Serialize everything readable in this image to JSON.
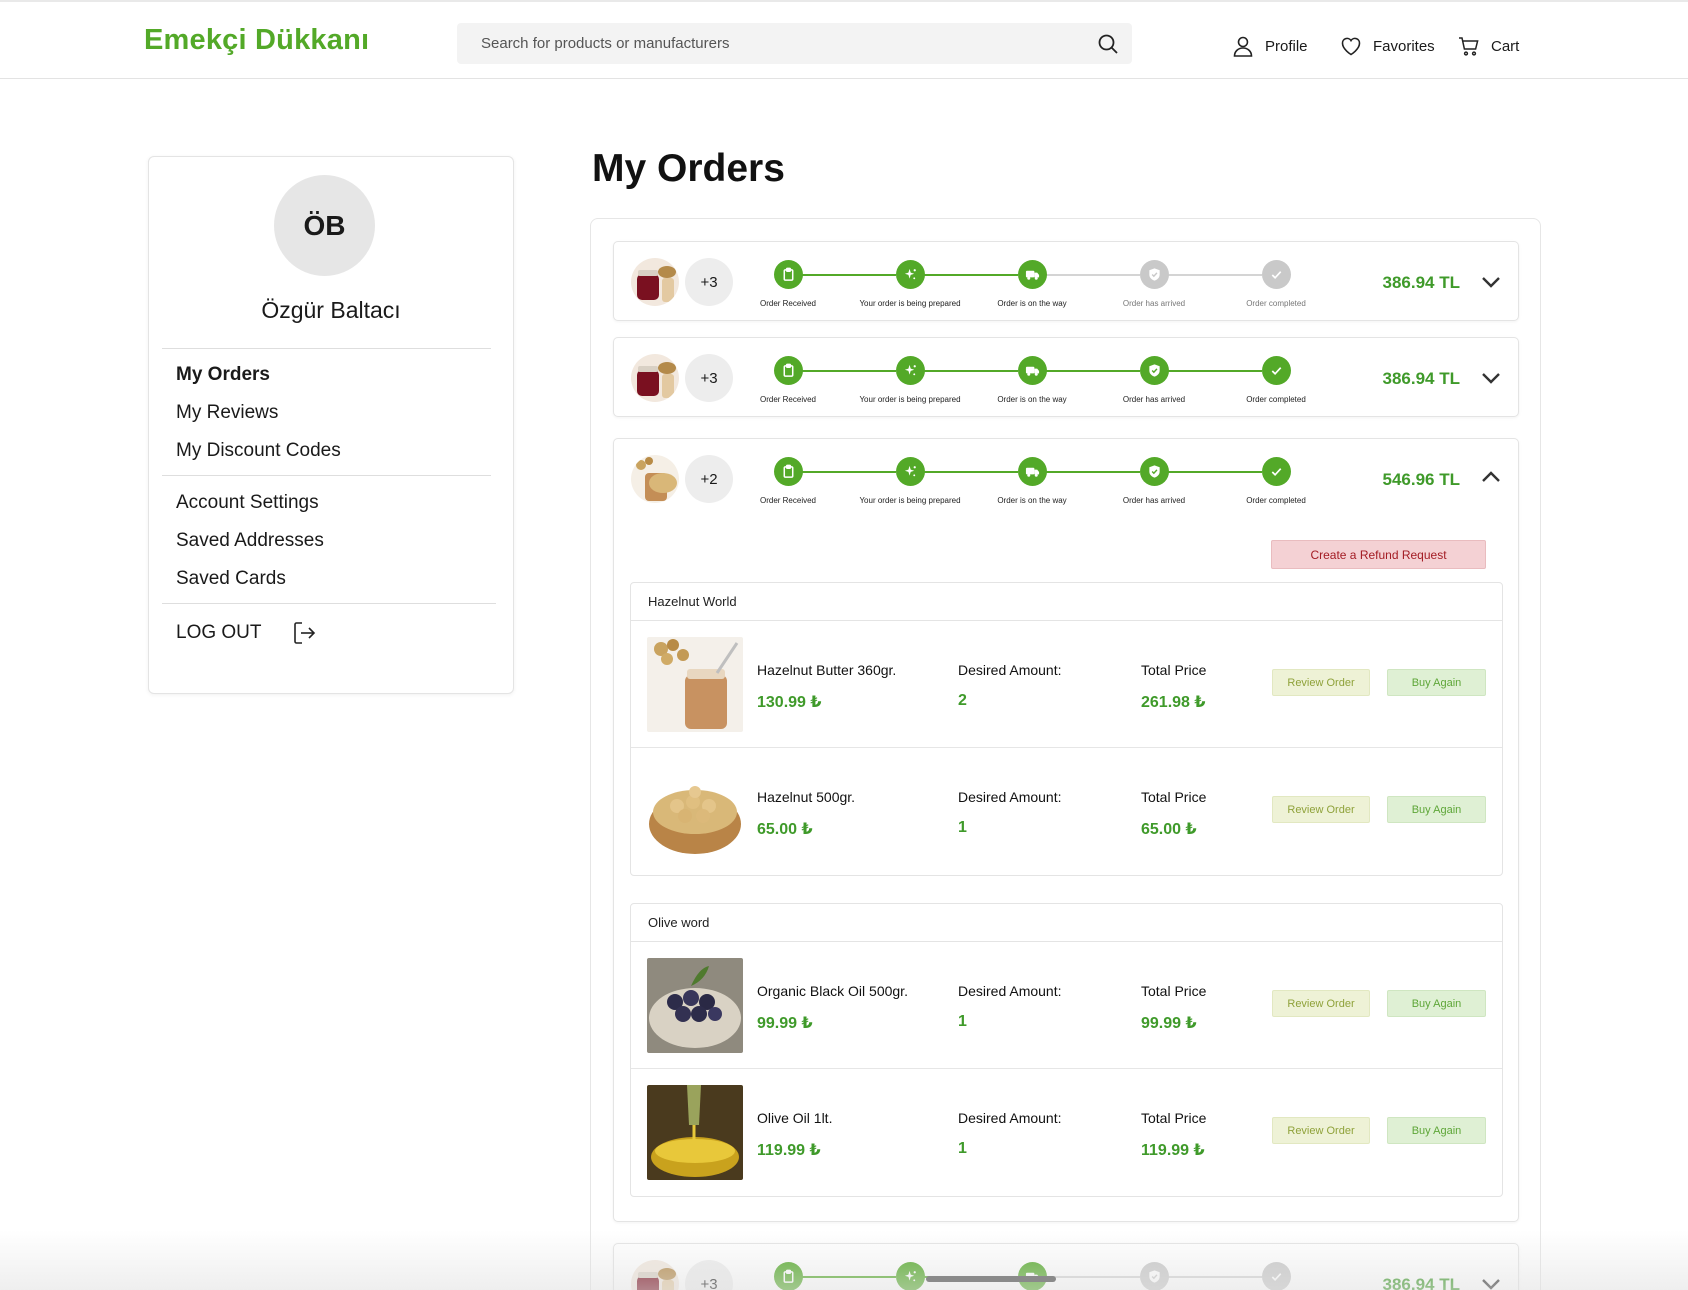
{
  "header": {
    "logo": "Emekçi Dükkanı",
    "search_placeholder": "Search for products or manufacturers",
    "nav": {
      "profile": "Profile",
      "favorites": "Favorites",
      "cart": "Cart"
    }
  },
  "sidebar": {
    "initials": "ÖB",
    "user_name": "Özgür Baltacı",
    "menu": {
      "my_orders": "My Orders",
      "my_reviews": "My Reviews",
      "my_discount_codes": "My Discount Codes",
      "account_settings": "Account Settings",
      "saved_addresses": "Saved Addresses",
      "saved_cards": "Saved Cards",
      "log_out": "LOG OUT"
    }
  },
  "main": {
    "title": "My Orders"
  },
  "steps": {
    "received": "Order Received",
    "prepared": "Your order is being prepared",
    "on_way": "Order is on the way",
    "arrived": "Order has arrived",
    "completed": "Order completed"
  },
  "orders": [
    {
      "extra": "+3",
      "total": "386.94 TL",
      "completed_steps": 3
    },
    {
      "extra": "+3",
      "total": "386.94 TL",
      "completed_steps": 5
    },
    {
      "extra": "+2",
      "total": "546.96 TL",
      "completed_steps": 5,
      "refund_label": "Create a Refund Request",
      "shops": [
        {
          "name": "Hazelnut World",
          "items": [
            {
              "name": "Hazelnut Butter 360gr.",
              "price": "130.99 ₺",
              "amount": "2",
              "total": "261.98 ₺"
            },
            {
              "name": "Hazelnut 500gr.",
              "price": "65.00 ₺",
              "amount": "1",
              "total": "65.00 ₺"
            }
          ]
        },
        {
          "name": "Olive word",
          "items": [
            {
              "name": "Organic Black Oil 500gr.",
              "price": "99.99 ₺",
              "amount": "1",
              "total": "99.99 ₺"
            },
            {
              "name": "Olive Oil 1lt.",
              "price": "119.99 ₺",
              "amount": "1",
              "total": "119.99 ₺"
            }
          ]
        }
      ]
    },
    {
      "extra": "+3",
      "total": "386.94 TL",
      "completed_steps": 3
    }
  ],
  "labels": {
    "desired_amount": "Desired Amount:",
    "total_price": "Total Price",
    "review_order": "Review Order",
    "buy_again": "Buy Again"
  },
  "colors": {
    "brand_green": "#53a928",
    "price_green": "#3f9a2a",
    "refund_red": "#a31c24"
  }
}
